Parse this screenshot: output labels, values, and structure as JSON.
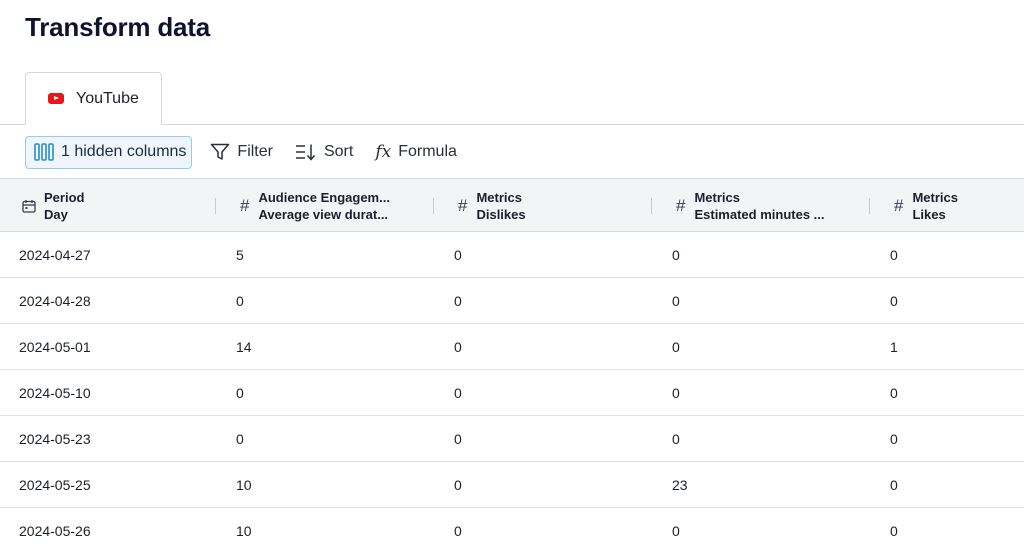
{
  "page": {
    "title": "Transform data"
  },
  "tabs": [
    {
      "label": "YouTube",
      "icon": "youtube-icon",
      "active": true
    }
  ],
  "toolbar": {
    "hidden_columns_label": "1 hidden columns",
    "filter_label": "Filter",
    "sort_label": "Sort",
    "formula_label": "Formula",
    "formula_icon_text": "fx"
  },
  "columns": [
    {
      "group": "Period",
      "name": "Day",
      "type": "date"
    },
    {
      "group": "Audience Engagem...",
      "name": "Average view durat...",
      "type": "number"
    },
    {
      "group": "Metrics",
      "name": "Dislikes",
      "type": "number"
    },
    {
      "group": "Metrics",
      "name": "Estimated minutes ...",
      "type": "number"
    },
    {
      "group": "Metrics",
      "name": "Likes",
      "type": "number"
    }
  ],
  "type_symbol": "#",
  "rows": [
    [
      "2024-04-27",
      "5",
      "0",
      "0",
      "0"
    ],
    [
      "2024-04-28",
      "0",
      "0",
      "0",
      "0"
    ],
    [
      "2024-05-01",
      "14",
      "0",
      "0",
      "1"
    ],
    [
      "2024-05-10",
      "0",
      "0",
      "0",
      "0"
    ],
    [
      "2024-05-23",
      "0",
      "0",
      "0",
      "0"
    ],
    [
      "2024-05-25",
      "10",
      "0",
      "23",
      "0"
    ],
    [
      "2024-05-26",
      "10",
      "0",
      "0",
      "0"
    ]
  ],
  "colors": {
    "accent_border": "#9bc9e6",
    "accent_bg": "#eef6fb",
    "youtube_red": "#e8161a"
  }
}
